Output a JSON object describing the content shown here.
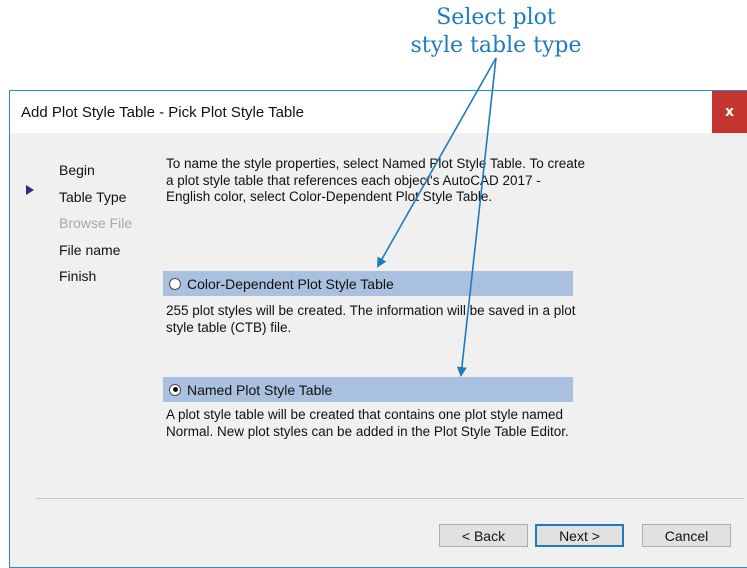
{
  "callout": {
    "line1": "Select plot",
    "line2": "style table type"
  },
  "dialog": {
    "title": "Add Plot Style Table - Pick Plot Style Table",
    "close_label": "x",
    "steps": [
      {
        "label": "Begin",
        "state": "normal"
      },
      {
        "label": "Table Type",
        "state": "current"
      },
      {
        "label": "Browse File",
        "state": "disabled"
      },
      {
        "label": "File name",
        "state": "normal"
      },
      {
        "label": "Finish",
        "state": "normal"
      }
    ],
    "intro": "To name the style properties, select Named Plot Style Table. To create a plot style table that references each object's AutoCAD 2017 - English color, select Color-Dependent Plot Style Table.",
    "options": [
      {
        "label": "Color-Dependent Plot Style Table",
        "selected": false,
        "description": "255 plot styles will be created. The information will be saved in a plot style table (CTB) file."
      },
      {
        "label": "Named Plot Style Table",
        "selected": true,
        "description": "A plot style table will be created that contains one plot style named Normal.  New plot styles can be added in the Plot Style Table Editor."
      }
    ],
    "buttons": {
      "back": "< Back",
      "next": "Next >",
      "cancel": "Cancel"
    }
  },
  "colors": {
    "accent": "#1f7bbf",
    "selection": "#a9c0de",
    "close": "#c3352e"
  }
}
